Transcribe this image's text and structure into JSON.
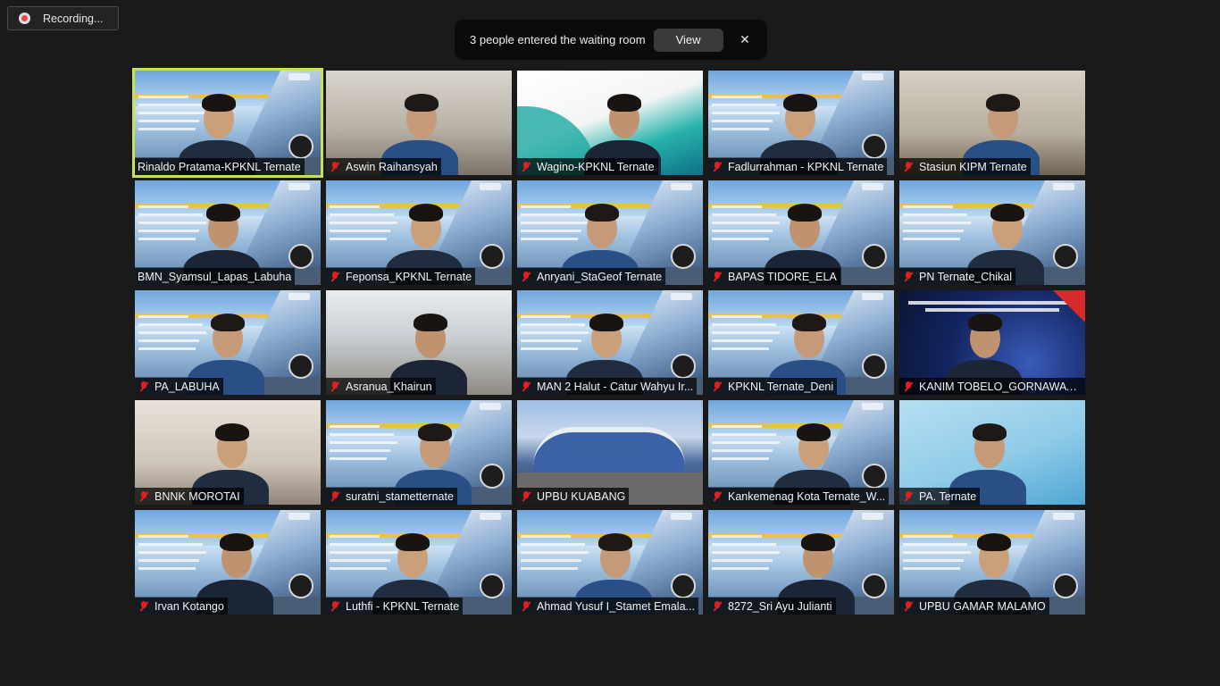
{
  "recording": {
    "label": "Recording..."
  },
  "notification": {
    "message": "3 people entered the waiting room",
    "view_label": "View",
    "close_icon": "close-icon"
  },
  "participants": [
    {
      "name": "Rinaldo Pratama-KPKNL Ternate",
      "muted": false,
      "active_speaker": true,
      "background": "slide"
    },
    {
      "name": "Aswin Raihansyah",
      "muted": true,
      "background": "office"
    },
    {
      "name": "Wagino-KPKNL Ternate",
      "muted": true,
      "background": "kpknl"
    },
    {
      "name": "Fadlurrahman - KPKNL Ternate",
      "muted": true,
      "background": "slide"
    },
    {
      "name": "Stasiun KIPM Ternate",
      "muted": true,
      "background": "plain"
    },
    {
      "name": "BMN_Syamsul_Lapas_Labuha",
      "muted": false,
      "background": "slide"
    },
    {
      "name": "Feponsa_KPKNL Ternate",
      "muted": true,
      "background": "slide"
    },
    {
      "name": "Anryani_StaGeof Ternate",
      "muted": true,
      "background": "slide"
    },
    {
      "name": "BAPAS TIDORE_ELA",
      "muted": true,
      "background": "slide"
    },
    {
      "name": "PN Ternate_Chikal",
      "muted": true,
      "background": "slide"
    },
    {
      "name": "PA_LABUHA",
      "muted": true,
      "background": "slide"
    },
    {
      "name": "Asranua_Khairun",
      "muted": true,
      "background": "airport"
    },
    {
      "name": "MAN 2 Halut - Catur Wahyu Ir...",
      "muted": true,
      "background": "slide"
    },
    {
      "name": "KPKNL Ternate_Deni",
      "muted": true,
      "background": "slide"
    },
    {
      "name": "KANIM TOBELO_GORNAWATI ...",
      "muted": true,
      "background": "kanim"
    },
    {
      "name": "BNNK MOROTAI",
      "muted": true,
      "background": "room"
    },
    {
      "name": "suratni_stametternate",
      "muted": true,
      "background": "slide"
    },
    {
      "name": "UPBU KUABANG",
      "muted": true,
      "background": "building"
    },
    {
      "name": "Kankemenag Kota Ternate_W...",
      "muted": true,
      "background": "slide"
    },
    {
      "name": "PA. Ternate",
      "muted": true,
      "background": "biro"
    },
    {
      "name": "Irvan Kotango",
      "muted": true,
      "background": "slide"
    },
    {
      "name": "Luthfi - KPKNL Ternate",
      "muted": true,
      "background": "slide"
    },
    {
      "name": "Ahmad Yusuf I_Stamet Emala...",
      "muted": true,
      "background": "slide"
    },
    {
      "name": "8272_Sri Ayu Julianti",
      "muted": true,
      "background": "slide"
    },
    {
      "name": "UPBU GAMAR MALAMO",
      "muted": true,
      "background": "slide"
    }
  ]
}
